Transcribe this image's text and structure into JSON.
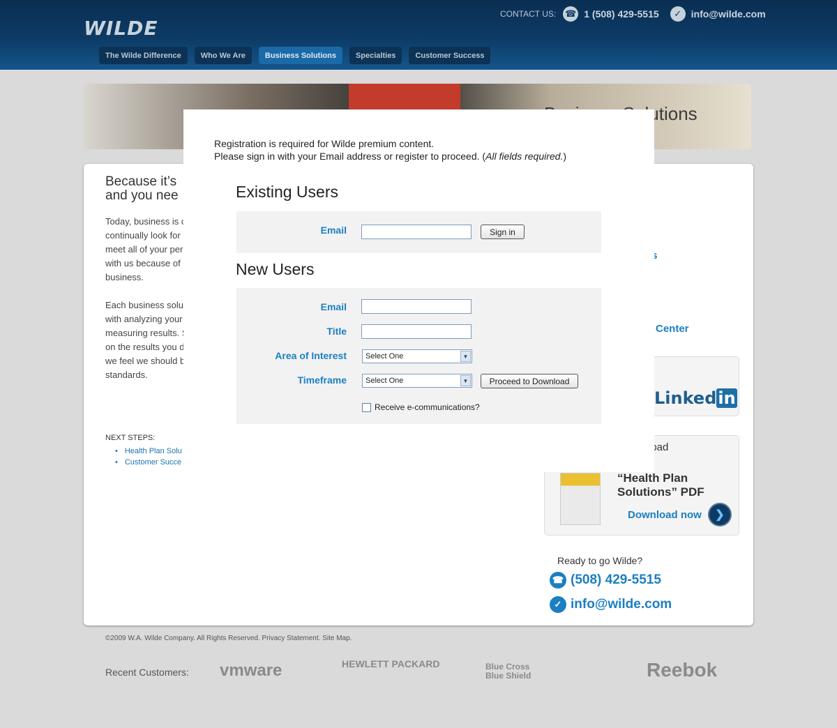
{
  "header": {
    "logo": "WILDE",
    "contact_label": "CONTACT US:",
    "phone": "1 (508) 429-5515",
    "email": "info@wilde.com"
  },
  "nav": [
    {
      "label": "The Wilde Difference"
    },
    {
      "label": "Who We Are"
    },
    {
      "label": "Business Solutions",
      "active": true
    },
    {
      "label": "Specialties"
    },
    {
      "label": "Customer Success"
    }
  ],
  "banner": {
    "title": "Business Solutions"
  },
  "left": {
    "heading_line1": "Because it’s",
    "heading_line2": "and you nee",
    "para1": [
      "Today, business is c",
      "continually look for ",
      "meet all of your per",
      "with us because of ",
      "business."
    ],
    "para2": [
      "Each business solu",
      "with analyzing your",
      "measuring results. S",
      "on the results you d",
      "we feel we should b",
      "standards."
    ],
    "next_steps_label": "NEXT STEPS:",
    "next_steps": [
      "Health Plan Solu",
      "Customer Succe"
    ]
  },
  "right": {
    "heading": "s",
    "links": [
      "s",
      "s",
      "ns",
      "s",
      "Center"
    ],
    "linkedin": "Linked",
    "linkedin_in": "in",
    "download_heading": "load",
    "download_title": "“Health Plan Solutions” PDF",
    "download_link": "Download now",
    "ready": "Ready to go Wilde?",
    "phone": "(508) 429-5515",
    "email": "info@wilde.com"
  },
  "footer": {
    "copyright": "©2009 W.A. Wilde Company. All Rights Reserved. Privacy Statement. Site Map.",
    "recent_label": "Recent Customers:",
    "customers": [
      "vmware",
      "HEWLETT PACKARD",
      "Blue Cross Blue Shield",
      "Reebok"
    ]
  },
  "modal": {
    "intro_line1": "Registration is required for Wilde premium content.",
    "intro_line2": "Please sign in with your Email address or register to proceed. (",
    "intro_italic": "All fields required.",
    "intro_close": ")",
    "existing_title": "Existing Users",
    "existing_email_label": "Email",
    "sign_in_label": "Sign in",
    "new_title": "New Users",
    "new_email_label": "Email",
    "title_label": "Title",
    "area_label": "Area of Interest",
    "area_value": "Select One",
    "timeframe_label": "Timeframe",
    "timeframe_value": "Select One",
    "proceed_label": "Proceed to Download",
    "ecomm_label": "Receive e-communications?"
  }
}
